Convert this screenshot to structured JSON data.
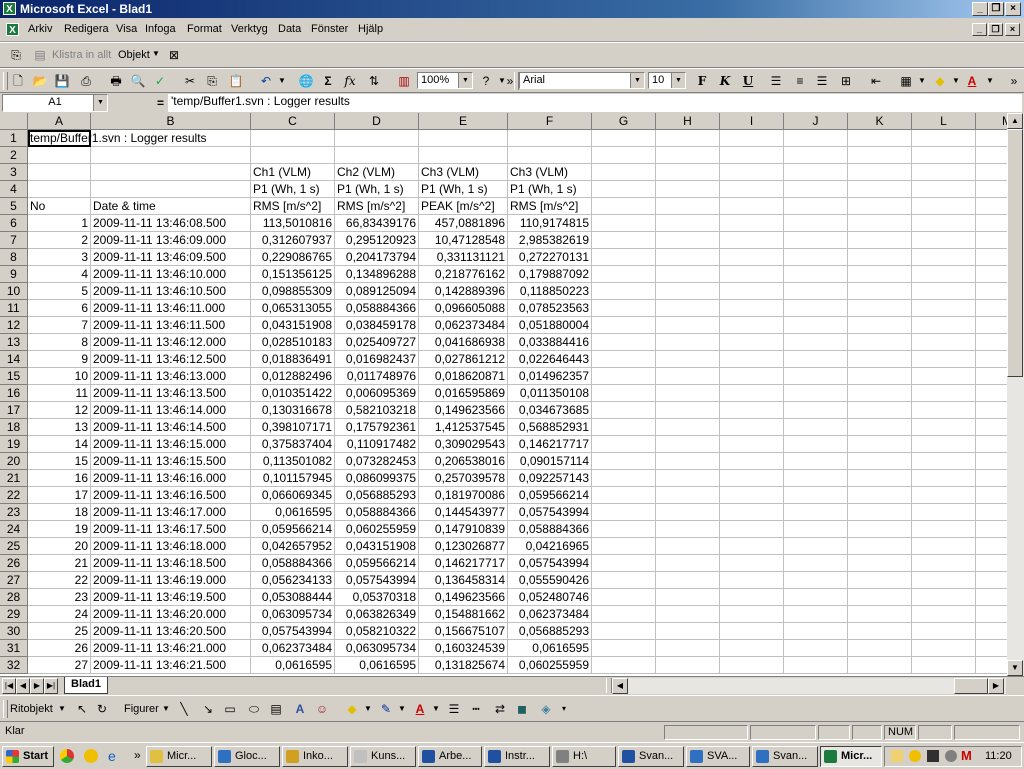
{
  "window": {
    "title": "Microsoft Excel - Blad1"
  },
  "menu": [
    "Arkiv",
    "Redigera",
    "Visa",
    "Infoga",
    "Format",
    "Verktyg",
    "Data",
    "Fönster",
    "Hjälp"
  ],
  "clipboard_toolbar": {
    "paste_all": "Klistra in allt",
    "object": "Objekt"
  },
  "standard_toolbar": {
    "zoom": "100%",
    "font": "Arial",
    "size": "10"
  },
  "formula_bar": {
    "name_box": "A1",
    "equals": "=",
    "content": "'temp/Buffer1.svn : Logger results"
  },
  "columns": [
    "A",
    "B",
    "C",
    "D",
    "E",
    "F",
    "G",
    "H",
    "I",
    "J",
    "K",
    "L",
    "M"
  ],
  "sheet": {
    "a1": "'temp/Buffer1.svn : Logger results",
    "ch_labels": [
      "Ch1 (VLM)",
      "Ch2 (VLM)",
      "Ch3 (VLM)",
      "Ch3 (VLM)"
    ],
    "p1_labels": [
      "P1 (Wh, 1 s)",
      "P1 (Wh, 1 s)",
      "P1 (Wh, 1 s)",
      "P1 (Wh, 1 s)"
    ],
    "header_no": "No",
    "header_date": "Date & time",
    "unit_labels": [
      "RMS [m/s^2]",
      "RMS [m/s^2]",
      "PEAK [m/s^2]",
      "RMS [m/s^2]"
    ],
    "rows": [
      [
        "1",
        "2009-11-11 13:46:08.500",
        "113,5010816",
        "66,83439176",
        "457,0881896",
        "110,9174815"
      ],
      [
        "2",
        "2009-11-11 13:46:09.000",
        "0,312607937",
        "0,295120923",
        "10,47128548",
        "2,985382619"
      ],
      [
        "3",
        "2009-11-11 13:46:09.500",
        "0,229086765",
        "0,204173794",
        "0,331131121",
        "0,272270131"
      ],
      [
        "4",
        "2009-11-11 13:46:10.000",
        "0,151356125",
        "0,134896288",
        "0,218776162",
        "0,179887092"
      ],
      [
        "5",
        "2009-11-11 13:46:10.500",
        "0,098855309",
        "0,089125094",
        "0,142889396",
        "0,118850223"
      ],
      [
        "6",
        "2009-11-11 13:46:11.000",
        "0,065313055",
        "0,058884366",
        "0,096605088",
        "0,078523563"
      ],
      [
        "7",
        "2009-11-11 13:46:11.500",
        "0,043151908",
        "0,038459178",
        "0,062373484",
        "0,051880004"
      ],
      [
        "8",
        "2009-11-11 13:46:12.000",
        "0,028510183",
        "0,025409727",
        "0,041686938",
        "0,033884416"
      ],
      [
        "9",
        "2009-11-11 13:46:12.500",
        "0,018836491",
        "0,016982437",
        "0,027861212",
        "0,022646443"
      ],
      [
        "10",
        "2009-11-11 13:46:13.000",
        "0,012882496",
        "0,011748976",
        "0,018620871",
        "0,014962357"
      ],
      [
        "11",
        "2009-11-11 13:46:13.500",
        "0,010351422",
        "0,006095369",
        "0,016595869",
        "0,011350108"
      ],
      [
        "12",
        "2009-11-11 13:46:14.000",
        "0,130316678",
        "0,582103218",
        "0,149623566",
        "0,034673685"
      ],
      [
        "13",
        "2009-11-11 13:46:14.500",
        "0,398107171",
        "0,175792361",
        "1,412537545",
        "0,568852931"
      ],
      [
        "14",
        "2009-11-11 13:46:15.000",
        "0,375837404",
        "0,110917482",
        "0,309029543",
        "0,146217717"
      ],
      [
        "15",
        "2009-11-11 13:46:15.500",
        "0,113501082",
        "0,073282453",
        "0,206538016",
        "0,090157114"
      ],
      [
        "16",
        "2009-11-11 13:46:16.000",
        "0,101157945",
        "0,086099375",
        "0,257039578",
        "0,092257143"
      ],
      [
        "17",
        "2009-11-11 13:46:16.500",
        "0,066069345",
        "0,056885293",
        "0,181970086",
        "0,059566214"
      ],
      [
        "18",
        "2009-11-11 13:46:17.000",
        "0,0616595",
        "0,058884366",
        "0,144543977",
        "0,057543994"
      ],
      [
        "19",
        "2009-11-11 13:46:17.500",
        "0,059566214",
        "0,060255959",
        "0,147910839",
        "0,058884366"
      ],
      [
        "20",
        "2009-11-11 13:46:18.000",
        "0,042657952",
        "0,043151908",
        "0,123026877",
        "0,04216965"
      ],
      [
        "21",
        "2009-11-11 13:46:18.500",
        "0,058884366",
        "0,059566214",
        "0,146217717",
        "0,057543994"
      ],
      [
        "22",
        "2009-11-11 13:46:19.000",
        "0,056234133",
        "0,057543994",
        "0,136458314",
        "0,055590426"
      ],
      [
        "23",
        "2009-11-11 13:46:19.500",
        "0,053088444",
        "0,05370318",
        "0,149623566",
        "0,052480746"
      ],
      [
        "24",
        "2009-11-11 13:46:20.000",
        "0,063095734",
        "0,063826349",
        "0,154881662",
        "0,062373484"
      ],
      [
        "25",
        "2009-11-11 13:46:20.500",
        "0,057543994",
        "0,058210322",
        "0,156675107",
        "0,056885293"
      ],
      [
        "26",
        "2009-11-11 13:46:21.000",
        "0,062373484",
        "0,063095734",
        "0,160324539",
        "0,0616595"
      ],
      [
        "27",
        "2009-11-11 13:46:21.500",
        "0,0616595",
        "0,0616595",
        "0,131825674",
        "0,060255959"
      ]
    ]
  },
  "sheet_tab": "Blad1",
  "drawing_toolbar": {
    "draw": "Ritobjekt",
    "shapes": "Figurer"
  },
  "status": {
    "left": "Klar",
    "num": "NUM"
  },
  "taskbar": {
    "start": "Start",
    "tasks": [
      "Micr...",
      "Gloc...",
      "Inko...",
      "Kuns...",
      "Arbe...",
      "Instr...",
      "H:\\",
      "Svan...",
      "SVA...",
      "Svan...",
      "Micr..."
    ],
    "clock": "11:20"
  }
}
